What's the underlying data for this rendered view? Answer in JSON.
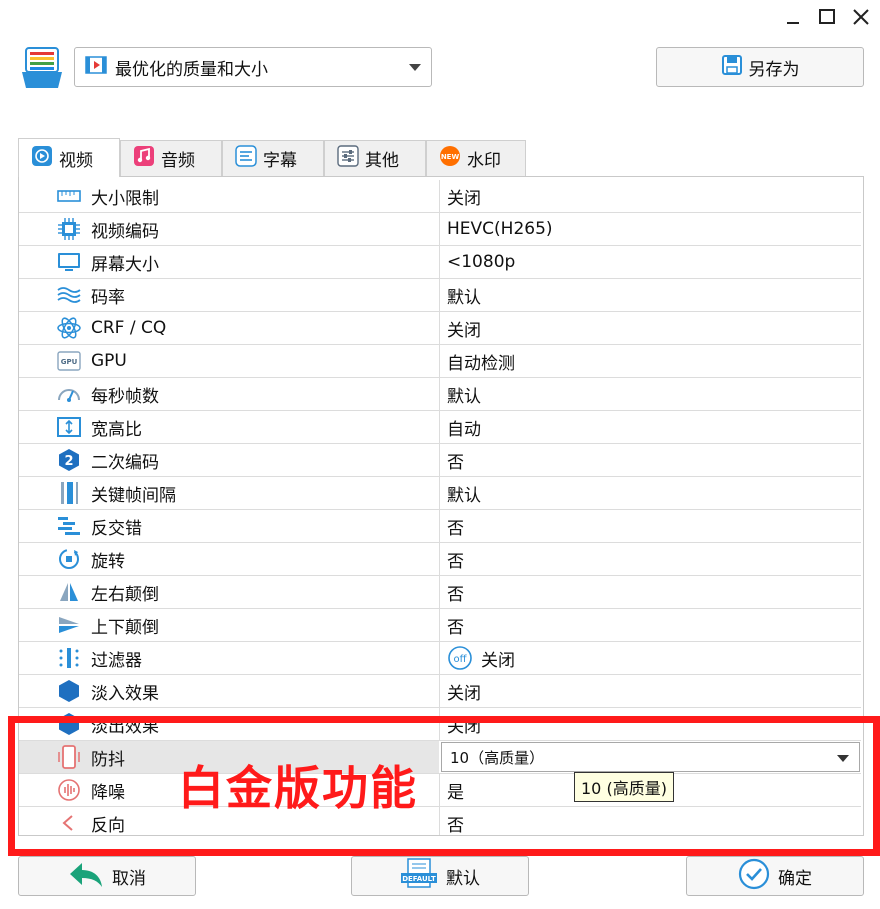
{
  "window": {
    "controls": [
      "minimize-icon",
      "maximize-icon",
      "close-icon"
    ]
  },
  "preset": {
    "selected": "最优化的质量和大小"
  },
  "save_as": {
    "label": "另存为"
  },
  "tabs": [
    {
      "label": "视频",
      "icon": "video-tab-icon",
      "active": true
    },
    {
      "label": "音频",
      "icon": "music-note-icon"
    },
    {
      "label": "字幕",
      "icon": "subtitle-icon"
    },
    {
      "label": "其他",
      "icon": "sliders-icon"
    },
    {
      "label": "水印",
      "icon": "new-badge-icon"
    }
  ],
  "settings": [
    {
      "label": "大小限制",
      "value": "关闭",
      "icon": "ruler-icon"
    },
    {
      "label": "视频编码",
      "value": "HEVC(H265)",
      "icon": "chip-icon"
    },
    {
      "label": "屏幕大小",
      "value": "<1080p",
      "icon": "monitor-icon"
    },
    {
      "label": "码率",
      "value": "默认",
      "icon": "waves-icon"
    },
    {
      "label": "CRF / CQ",
      "value": "关闭",
      "icon": "atom-icon"
    },
    {
      "label": "GPU",
      "value": "自动检测",
      "icon": "gpu-icon"
    },
    {
      "label": "每秒帧数",
      "value": "默认",
      "icon": "speedometer-icon"
    },
    {
      "label": "宽高比",
      "value": "自动",
      "icon": "aspect-ratio-icon"
    },
    {
      "label": "二次编码",
      "value": "否",
      "icon": "hexagon-two-icon"
    },
    {
      "label": "关键帧间隔",
      "value": "默认",
      "icon": "keyframe-icon"
    },
    {
      "label": "反交错",
      "value": "否",
      "icon": "deinterlace-icon"
    },
    {
      "label": "旋转",
      "value": "否",
      "icon": "rotate-icon"
    },
    {
      "label": "左右颠倒",
      "value": "否",
      "icon": "flip-horizontal-icon"
    },
    {
      "label": "上下颠倒",
      "value": "否",
      "icon": "flip-vertical-icon"
    },
    {
      "label": "过滤器",
      "value": "关闭",
      "icon": "filter-icon",
      "off_badge": "off"
    },
    {
      "label": "淡入效果",
      "value": "关闭",
      "icon": "fade-in-icon"
    },
    {
      "label": "淡出效果",
      "value": "关闭",
      "icon": "fade-out-icon"
    },
    {
      "label": "防抖",
      "value": "10（高质量）",
      "icon": "stabilize-phone-icon",
      "dropdown": true
    },
    {
      "label": "降噪",
      "value": "是",
      "icon": "denoise-icon"
    },
    {
      "label": "反向",
      "value": "否",
      "icon": "reverse-icon"
    }
  ],
  "tooltip": {
    "text": "10 (高质量)"
  },
  "overlay": {
    "text": "白金版功能",
    "color": "#ff1a1a"
  },
  "buttons": {
    "cancel": "取消",
    "default": "默认",
    "ok": "确定",
    "default_badge": "DEFAULT"
  },
  "colors": {
    "accent": "#2a8fd8",
    "highlight": "#ff1a1a"
  }
}
